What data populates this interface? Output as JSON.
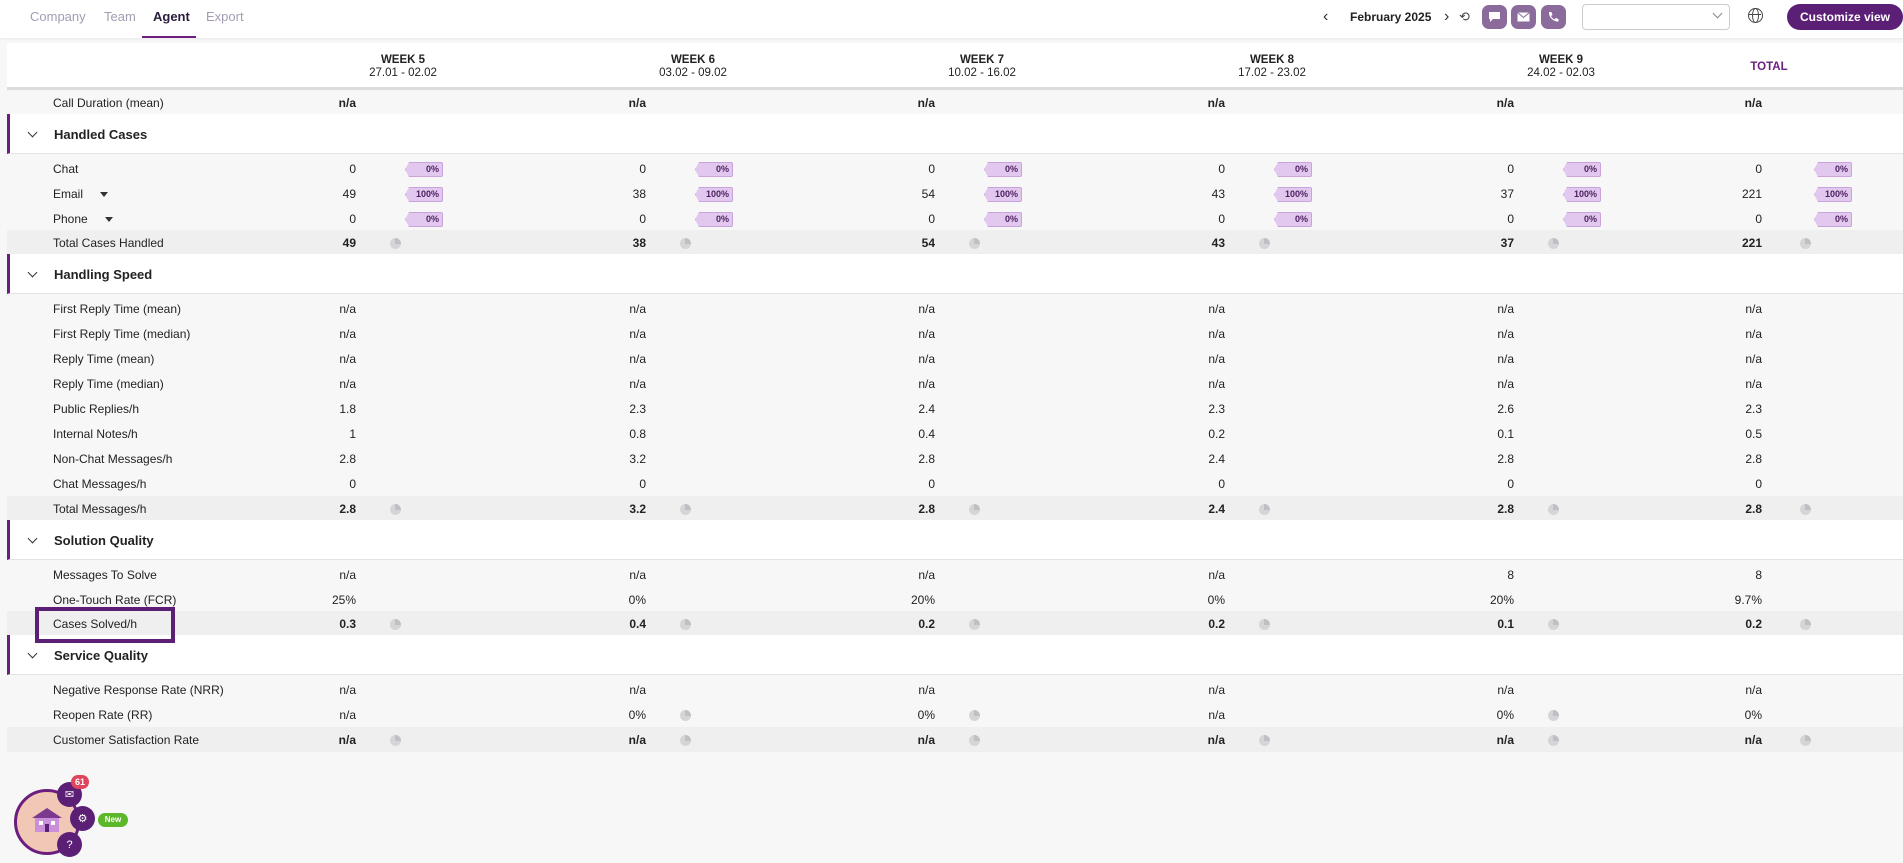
{
  "nav": {
    "tabs": [
      {
        "label": "Company"
      },
      {
        "label": "Team"
      },
      {
        "label": "Agent"
      },
      {
        "label": "Export"
      }
    ],
    "period": "February 2025",
    "customize_label": "Customize view",
    "select_value": ""
  },
  "header": {
    "weeks": [
      {
        "name": "WEEK 5",
        "range": "27.01 - 02.02"
      },
      {
        "name": "WEEK 6",
        "range": "03.02 - 09.02"
      },
      {
        "name": "WEEK 7",
        "range": "10.02 - 16.02"
      },
      {
        "name": "WEEK 8",
        "range": "17.02 - 23.02"
      },
      {
        "name": "WEEK 9",
        "range": "24.02 - 02.03"
      }
    ],
    "total": "TOTAL"
  },
  "rows": {
    "call_duration": {
      "label": "Call Duration (mean)",
      "values": [
        "n/a",
        "n/a",
        "n/a",
        "n/a",
        "n/a",
        "n/a"
      ]
    }
  },
  "sections": {
    "handled": {
      "title": "Handled Cases",
      "chat": {
        "label": "Chat",
        "values": [
          "0",
          "0",
          "0",
          "0",
          "0",
          "0"
        ],
        "pct": [
          "0%",
          "0%",
          "0%",
          "0%",
          "0%",
          "0%"
        ]
      },
      "email": {
        "label": "Email",
        "values": [
          "49",
          "38",
          "54",
          "43",
          "37",
          "221"
        ],
        "pct": [
          "100%",
          "100%",
          "100%",
          "100%",
          "100%",
          "100%"
        ]
      },
      "phone": {
        "label": "Phone",
        "values": [
          "0",
          "0",
          "0",
          "0",
          "0",
          "0"
        ],
        "pct": [
          "0%",
          "0%",
          "0%",
          "0%",
          "0%",
          "0%"
        ]
      },
      "total": {
        "label": "Total Cases Handled",
        "values": [
          "49",
          "38",
          "54",
          "43",
          "37",
          "221"
        ]
      }
    },
    "speed": {
      "title": "Handling Speed",
      "rows": [
        {
          "label": "First Reply Time (mean)",
          "values": [
            "n/a",
            "n/a",
            "n/a",
            "n/a",
            "n/a",
            "n/a"
          ]
        },
        {
          "label": "First Reply Time (median)",
          "values": [
            "n/a",
            "n/a",
            "n/a",
            "n/a",
            "n/a",
            "n/a"
          ]
        },
        {
          "label": "Reply Time (mean)",
          "values": [
            "n/a",
            "n/a",
            "n/a",
            "n/a",
            "n/a",
            "n/a"
          ]
        },
        {
          "label": "Reply Time (median)",
          "values": [
            "n/a",
            "n/a",
            "n/a",
            "n/a",
            "n/a",
            "n/a"
          ]
        },
        {
          "label": "Public Replies/h",
          "values": [
            "1.8",
            "2.3",
            "2.4",
            "2.3",
            "2.6",
            "2.3"
          ]
        },
        {
          "label": "Internal Notes/h",
          "values": [
            "1",
            "0.8",
            "0.4",
            "0.2",
            "0.1",
            "0.5"
          ]
        },
        {
          "label": "Non-Chat Messages/h",
          "values": [
            "2.8",
            "3.2",
            "2.8",
            "2.4",
            "2.8",
            "2.8"
          ]
        },
        {
          "label": "Chat Messages/h",
          "values": [
            "0",
            "0",
            "0",
            "0",
            "0",
            "0"
          ]
        }
      ],
      "total": {
        "label": "Total Messages/h",
        "values": [
          "2.8",
          "3.2",
          "2.8",
          "2.4",
          "2.8",
          "2.8"
        ]
      }
    },
    "quality": {
      "title": "Solution Quality",
      "rows": [
        {
          "label": "Messages To Solve",
          "values": [
            "n/a",
            "n/a",
            "n/a",
            "n/a",
            "8",
            "8"
          ]
        },
        {
          "label": "One-Touch Rate (FCR)",
          "values": [
            "25%",
            "0%",
            "20%",
            "0%",
            "20%",
            "9.7%"
          ]
        }
      ],
      "total": {
        "label": "Cases Solved/h",
        "values": [
          "0.3",
          "0.4",
          "0.2",
          "0.2",
          "0.1",
          "0.2"
        ]
      }
    },
    "service": {
      "title": "Service Quality",
      "nrr": {
        "label": "Negative Response Rate (NRR)",
        "values": [
          "n/a",
          "n/a",
          "n/a",
          "n/a",
          "n/a",
          "n/a"
        ]
      },
      "rr": {
        "label": "Reopen Rate (RR)",
        "values": [
          "n/a",
          "0%",
          "0%",
          "n/a",
          "0%",
          "0%"
        ]
      },
      "csat": {
        "label": "Customer Satisfaction Rate",
        "values": [
          "n/a",
          "n/a",
          "n/a",
          "n/a",
          "n/a",
          "n/a"
        ]
      }
    }
  },
  "widget": {
    "notification_count": "61",
    "new_label": "New"
  },
  "colors": {
    "accent": "#6b1e7e",
    "button": "#5b1f76",
    "pill": "#e2c8ee",
    "badge": "#e0455c",
    "new_badge": "#5cb82a"
  }
}
